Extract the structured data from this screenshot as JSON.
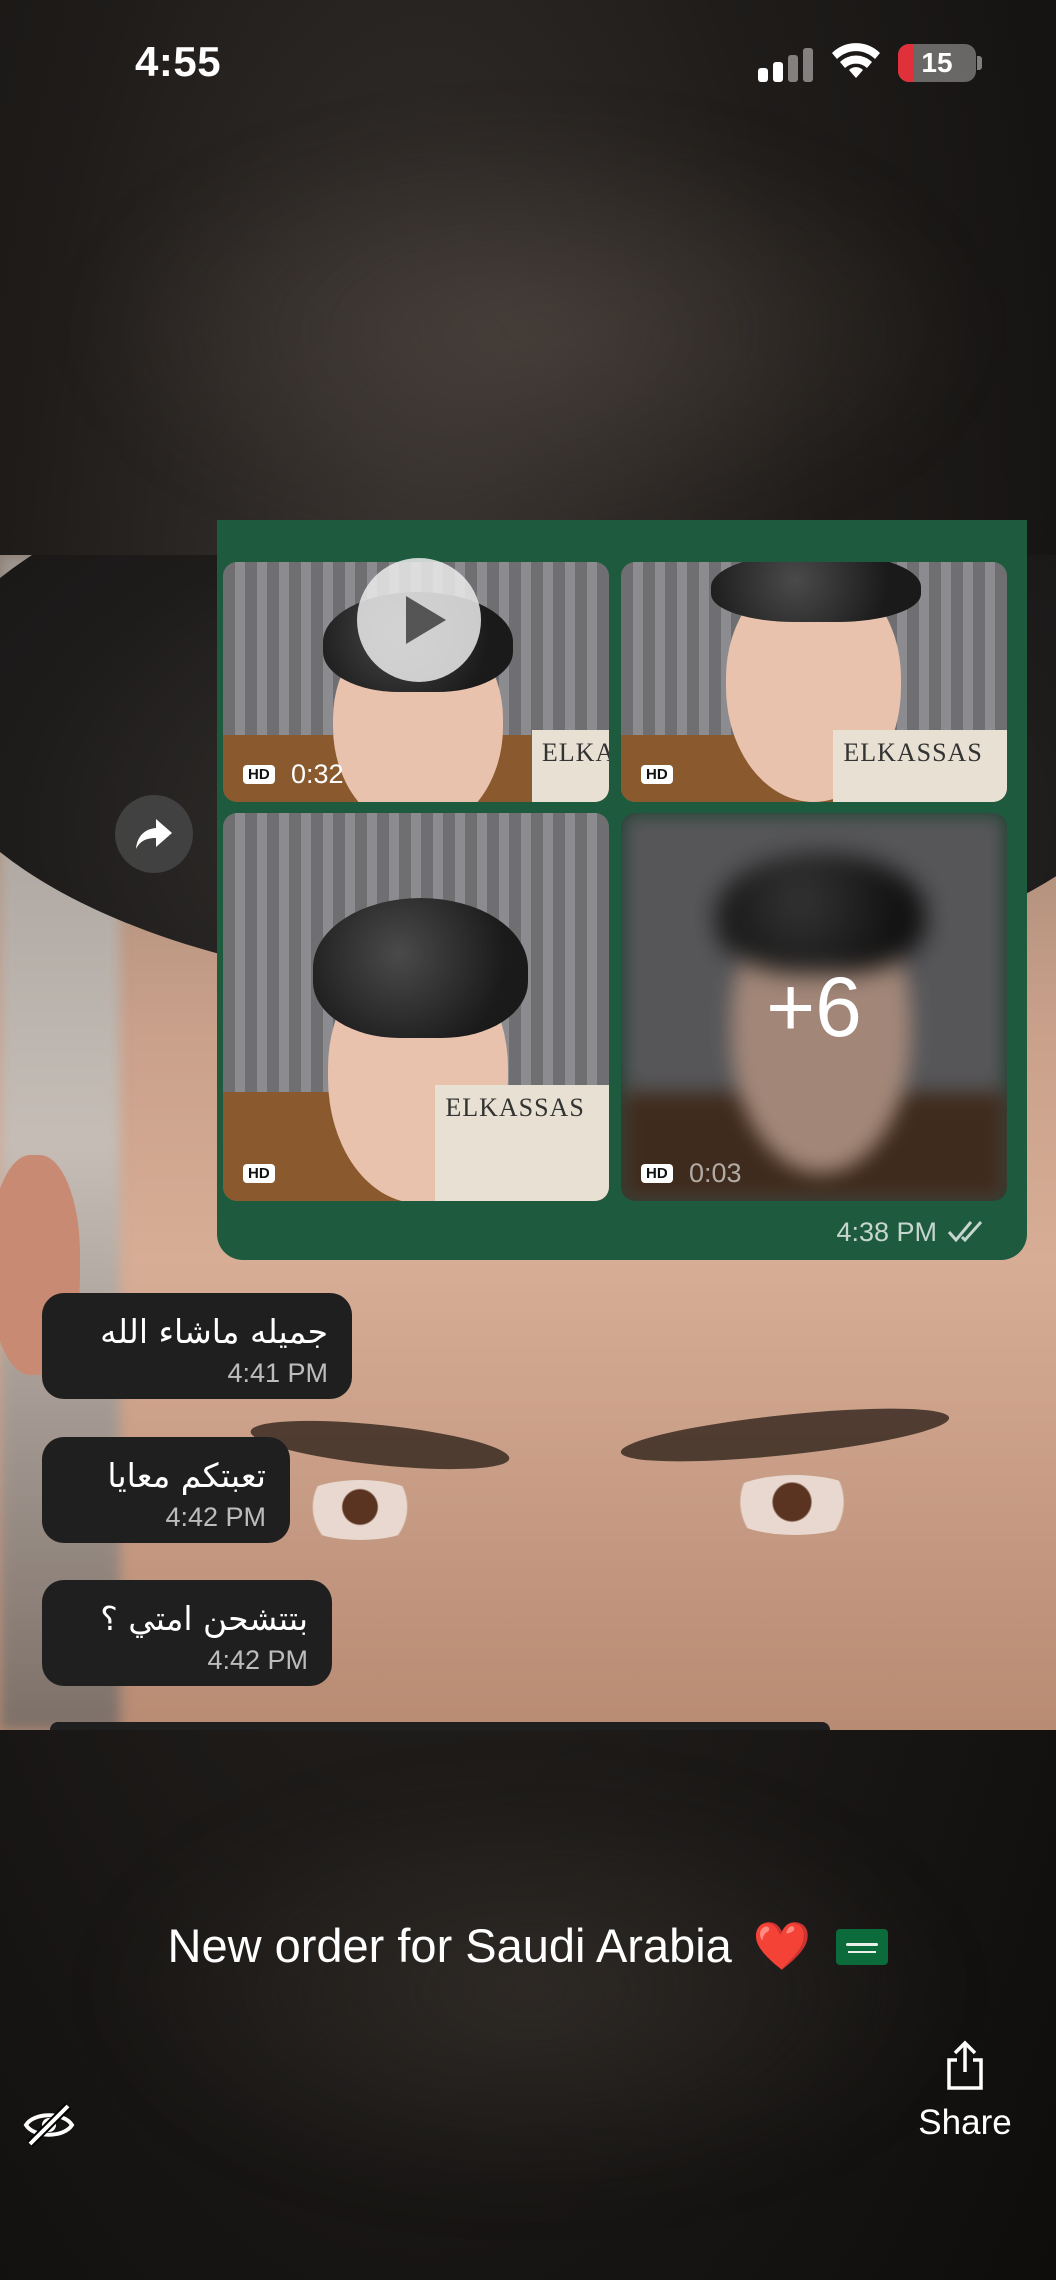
{
  "status_bar": {
    "time": "4:55",
    "battery_level": "15"
  },
  "forward_button": {
    "icon": "forward-arrow-icon"
  },
  "media_bubble": {
    "tiles": [
      {
        "badge": "HD",
        "duration": "0:32",
        "is_video": true
      },
      {
        "badge": "HD",
        "duration": ""
      },
      {
        "badge": "HD",
        "duration": ""
      },
      {
        "badge": "HD",
        "duration": "0:03",
        "more_count": "+6"
      }
    ],
    "logo_text": "ELKASSAS",
    "time": "4:38 PM",
    "read_receipt": "double-check-icon"
  },
  "messages": [
    {
      "text": "جميله ماشاء الله",
      "time": "4:41 PM"
    },
    {
      "text": "تعبتكم معايا",
      "time": "4:42 PM"
    },
    {
      "text": "بتتشحن امتي ؟",
      "time": "4:42 PM"
    }
  ],
  "caption": {
    "text": "New order for Saudi Arabia",
    "emoji": "❤️"
  },
  "share": {
    "label": "Share"
  },
  "colors": {
    "bubble_green": "#1d5a3e",
    "bubble_dark": "#1f1f1f",
    "heart": "#e11d2d"
  }
}
